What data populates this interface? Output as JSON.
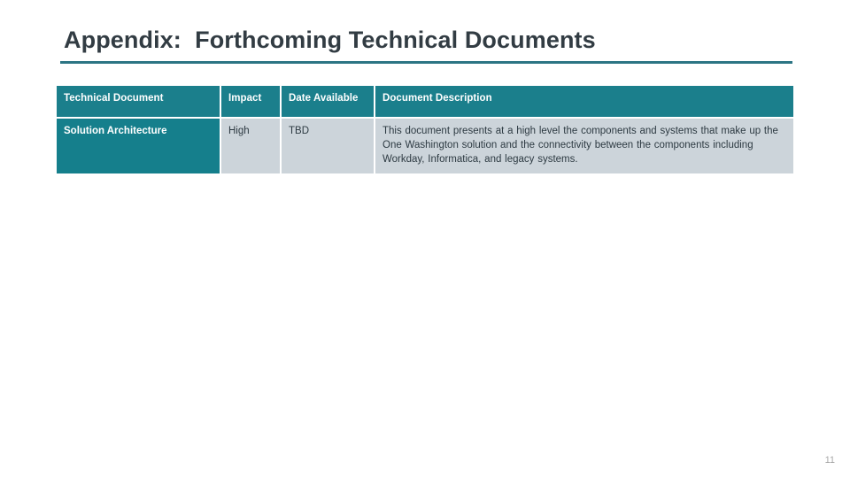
{
  "slide": {
    "title": "Appendix:  Forthcoming Technical Documents",
    "page_number": "11",
    "accent_color": "#157f8c",
    "header_color": "#1b7f8c",
    "cell_color": "#ccd4da",
    "rule_color": "#2c7584",
    "title_color": "#323c43",
    "body_text_color": "#2d3a42",
    "page_number_color": "#a9a9a9"
  },
  "table": {
    "columns": [
      "Technical Document",
      "Impact",
      "Date Available",
      "Document Description"
    ],
    "rows": [
      {
        "document": "Solution Architecture",
        "impact": "High",
        "date_available": "TBD",
        "description": "This document presents at a high level the components and systems that make up the One Washington solution and the connectivity between the components including Workday, Informatica, and legacy systems."
      }
    ]
  }
}
